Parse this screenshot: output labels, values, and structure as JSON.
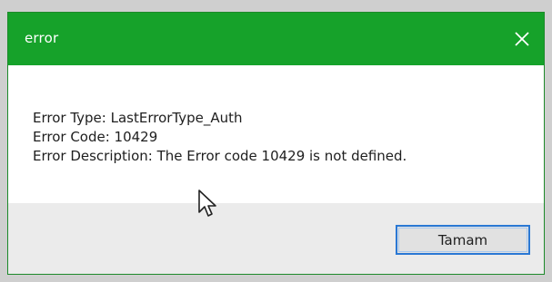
{
  "window": {
    "title": "error",
    "close_icon": "close-icon",
    "accent_color": "#16a22a"
  },
  "message": {
    "error_type": "Error Type: LastErrorType_Auth",
    "error_code": "Error Code: 10429",
    "error_description": "Error Description: The Error code 10429 is not defined."
  },
  "buttons": {
    "ok_label": "Tamam"
  },
  "pointer": {
    "icon": "mouse-pointer-icon"
  }
}
